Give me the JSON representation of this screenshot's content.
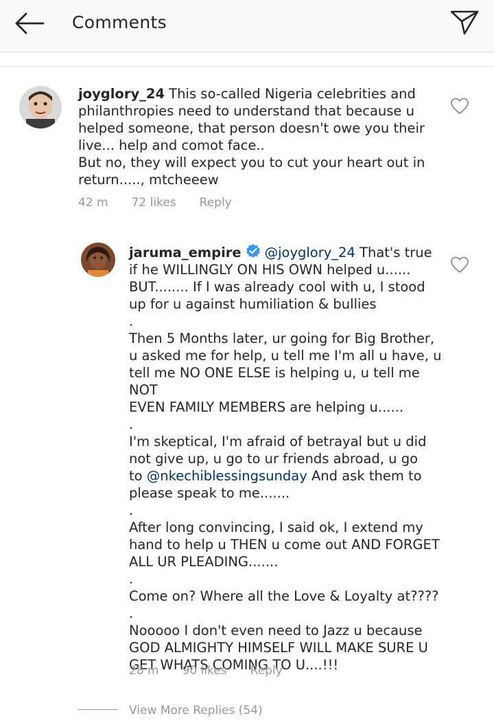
{
  "header": {
    "title": "Comments"
  },
  "comments": [
    {
      "username": "joyglory_24",
      "text": "This so-called Nigeria celebrities and\nphilanthropies need to understand that because u\nhelped someone, that person doesn't owe you their\nlive... help and comot face..\nBut no, they will expect you to cut your heart out in\nreturn....., mtcheeew",
      "time": "42 m",
      "likes": "72 likes",
      "reply_label": "Reply"
    }
  ],
  "reply": {
    "username": "jaruma_empire",
    "mention": "@joyglory_24",
    "text_first": "That's true\nif he WILLINGLY ON HIS OWN helped u......\nBUT........ If I was already cool with u, I stood\nup for u against humiliation & bullies\n.\nThen 5 Months later, ur going for Big Brother,\nu asked me for help, u tell me I'm all u have, u\ntell me NO ONE ELSE is helping u, u tell me NOT\nEVEN FAMILY MEMBERS are helping u......\n.\nI'm skeptical, I'm afraid of betrayal but u did\nnot give up, u go to ur friends abroad, u go\nto ",
    "mention2": "@nkechiblessingsunday",
    "text_second": " And ask them to\nplease speak to me.......\n.\nAfter long convincing, I said ok, I extend my\nhand to help u THEN u come out AND FORGET\nALL UR PLEADING.......\n.\nCome on? Where all the Love & Loyalty at????\n.\nNooooo I don't even need to Jazz u because\nGOD ALMIGHTY HIMSELF WILL MAKE SURE U\nGET WHATS COMING TO U....!!!",
    "time": "28 m",
    "likes": "90 likes",
    "reply_label": "Reply"
  },
  "footer": {
    "view_more": "View More Replies (54)"
  },
  "colors": {
    "mention": "#003569",
    "meta": "#999999",
    "verified": "#3897f0"
  },
  "icons": [
    "back-arrow-icon",
    "send-icon",
    "heart-icon",
    "verified-badge-icon"
  ]
}
